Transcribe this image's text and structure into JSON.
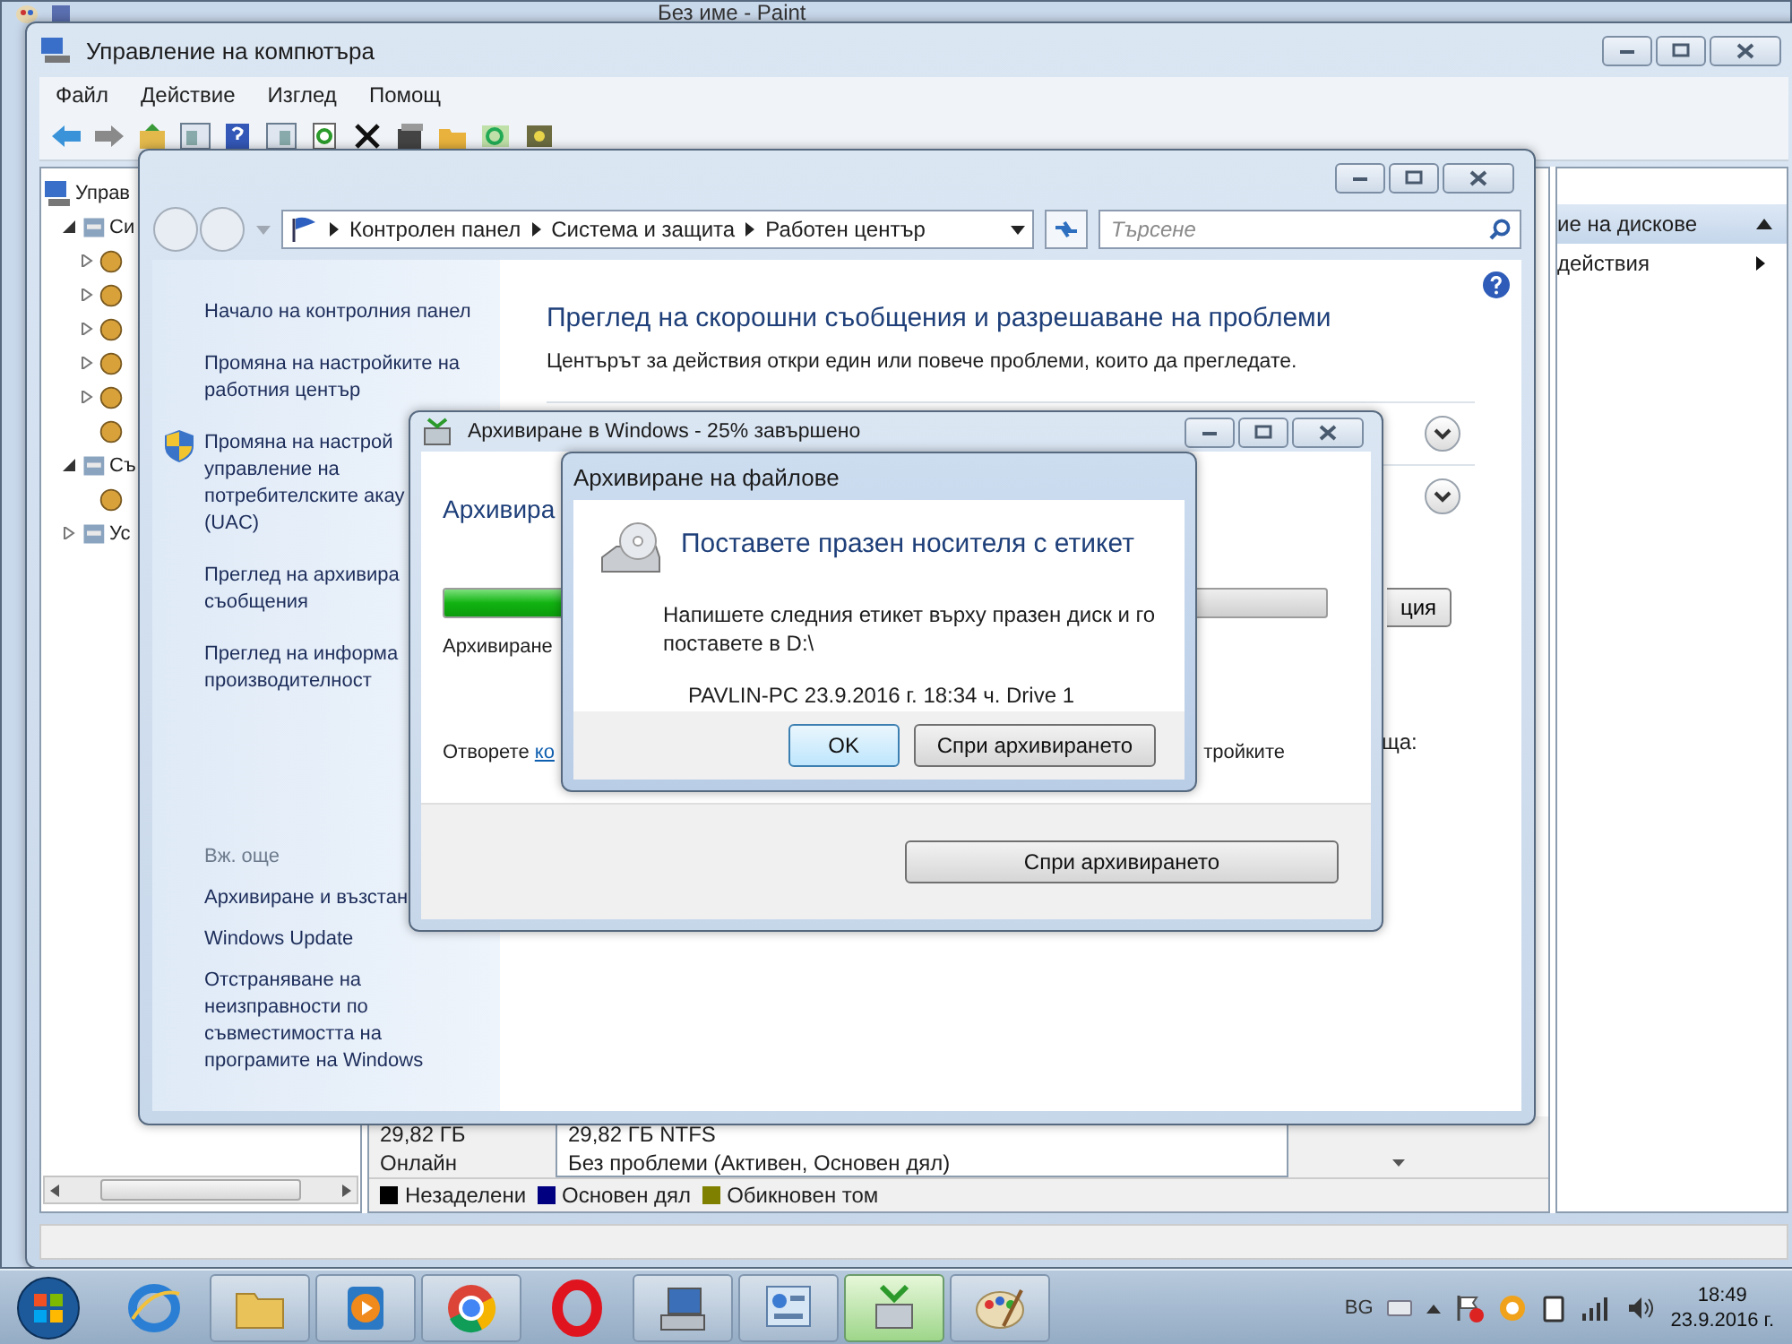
{
  "paint_window": {
    "title": "Без име - Paint"
  },
  "computer_management": {
    "title": "Управление на компютъра",
    "menu": [
      "Файл",
      "Действие",
      "Изглед",
      "Помощ"
    ],
    "tree": [
      {
        "label": "Управ",
        "children": [
          {
            "label": "Си",
            "kind": "node",
            "expanded": true,
            "children": [
              {
                "kind": "node",
                "expanded": false
              },
              {
                "kind": "node",
                "expanded": false
              },
              {
                "kind": "node",
                "expanded": false
              },
              {
                "kind": "node",
                "expanded": false
              },
              {
                "kind": "node",
                "expanded": false
              },
              {
                "kind": "leaf"
              }
            ]
          },
          {
            "label": "Съ",
            "kind": "node",
            "expanded": true,
            "children": [
              {
                "kind": "leaf"
              }
            ]
          },
          {
            "label": "Ус",
            "kind": "node",
            "expanded": false
          }
        ]
      }
    ],
    "actions": {
      "header": "ие на дискове",
      "items": [
        "действия"
      ]
    },
    "disk": {
      "size": "29,82 ГБ",
      "status": "Онлайн",
      "volume_size": "29,82 ГБ NTFS",
      "volume_status": "Без проблеми (Активен, Основен дял)"
    },
    "legend": [
      {
        "label": "Незаделени",
        "color": "#000000"
      },
      {
        "label": "Основен дял",
        "color": "#000080"
      },
      {
        "label": "Обикновен том",
        "color": "#808000"
      }
    ]
  },
  "action_center": {
    "breadcrumb": [
      "Контролен панел",
      "Система и защита",
      "Работен център"
    ],
    "search": {
      "placeholder": "Търсене"
    },
    "sidebar": [
      {
        "label": "Начало на контролния панел",
        "kind": "plain"
      },
      {
        "label": "Промяна на настройките на\nработния център",
        "kind": "plain"
      },
      {
        "label": "Промяна на настрой\nуправление на\nпотребителските акау\n(UAC)",
        "kind": "shield"
      },
      {
        "label": "Преглед на архивира\nсъобщения",
        "kind": "plain"
      },
      {
        "label": "Преглед на информа\nпроизводителност",
        "kind": "plain"
      }
    ],
    "see_also_title": "Вж. още",
    "see_also": [
      "Архивиране и възстан",
      "Windows Update",
      "Отстраняване на\nнеизправности по\nсъвместимостта на\nпрограмите на Windows"
    ],
    "heading": "Преглед на скорошни съобщения и разрешаване на проблеми",
    "intro": "Центърът за действия откри един или повече проблеми, които да прегледате.",
    "sections": [
      {
        "expanded": false
      },
      {
        "expanded": false
      }
    ],
    "partial_button": "ция",
    "partial_text": "ща:"
  },
  "backup_window": {
    "title": "Архивиране в Windows - 25% завършено",
    "heading": "Архивира",
    "level": 0.25,
    "status": "Архивиране",
    "footer_text": "Отворете",
    "footer_link": "ко",
    "footer_tail": "тройките",
    "button": "Спри архивирането"
  },
  "dialog": {
    "title": "Архивиране на файлове",
    "heading": "Поставете празен носителя с етикет",
    "message": "Напишете следния етикет върху празен диск и го\nпоставете в D:\\",
    "label": "PAVLIN-PC 23.9.2016 г. 18:34 ч. Drive 1",
    "buttons": [
      {
        "label": "OK",
        "default": true
      },
      {
        "label": "Спри архивирането",
        "default": false
      }
    ]
  },
  "taskbar": {
    "items": [
      {
        "kind": "ie",
        "running": false,
        "selected": false
      },
      {
        "kind": "explorer",
        "running": true,
        "selected": false
      },
      {
        "kind": "media",
        "running": true,
        "selected": false
      },
      {
        "kind": "chrome",
        "running": true,
        "selected": false
      },
      {
        "kind": "opera",
        "running": false,
        "selected": false
      },
      {
        "kind": "computer",
        "running": true,
        "selected": false
      },
      {
        "kind": "control",
        "running": true,
        "selected": false
      },
      {
        "kind": "backup",
        "running": true,
        "selected": true
      },
      {
        "kind": "paint",
        "running": true,
        "selected": false
      }
    ],
    "language": "BG",
    "time": "18:49",
    "date": "23.9.2016 г."
  }
}
